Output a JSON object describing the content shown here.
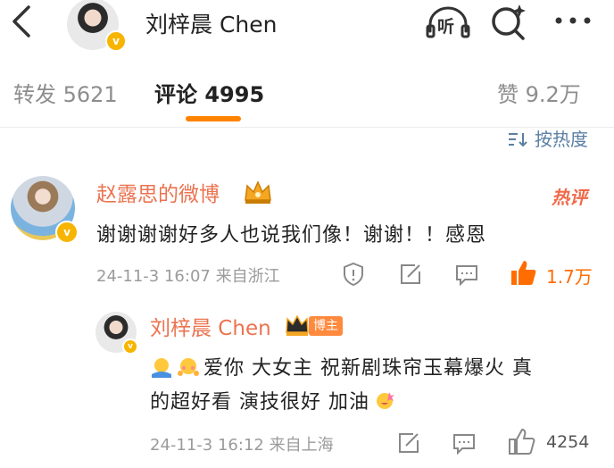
{
  "header": {
    "title": "刘梓晨 Chen",
    "verified_badge": "v",
    "icons": [
      "back-icon",
      "listen-icon",
      "search-icon",
      "more-icon"
    ],
    "listen_label": "听"
  },
  "tabs": {
    "repost": "转发 5621",
    "comment": "评论 4995",
    "like": "赞 9.2万",
    "active": "comment"
  },
  "sort": {
    "label": "按热度"
  },
  "comments": [
    {
      "author": "赵露思的微博",
      "badge": "热评",
      "text": "谢谢谢谢好多人也说我们像！谢谢！！感恩",
      "meta": "24-11-3 16:07  来自浙江",
      "likes": "1.7万",
      "replies": [
        {
          "author": "刘梓晨 Chen",
          "author_badge": "博主",
          "line1": "爱你 大女主 祝新剧珠帘玉幕爆火 真",
          "line2": "的超好看 演技很好 加油",
          "meta": "24-11-3 16:12  来自上海",
          "likes": "4254"
        }
      ]
    }
  ],
  "colors": {
    "accent": "#ff8200",
    "name": "#eb7350",
    "link": "#5b7fa3",
    "muted": "#9b9b9b",
    "like_active": "#ff6d00"
  }
}
